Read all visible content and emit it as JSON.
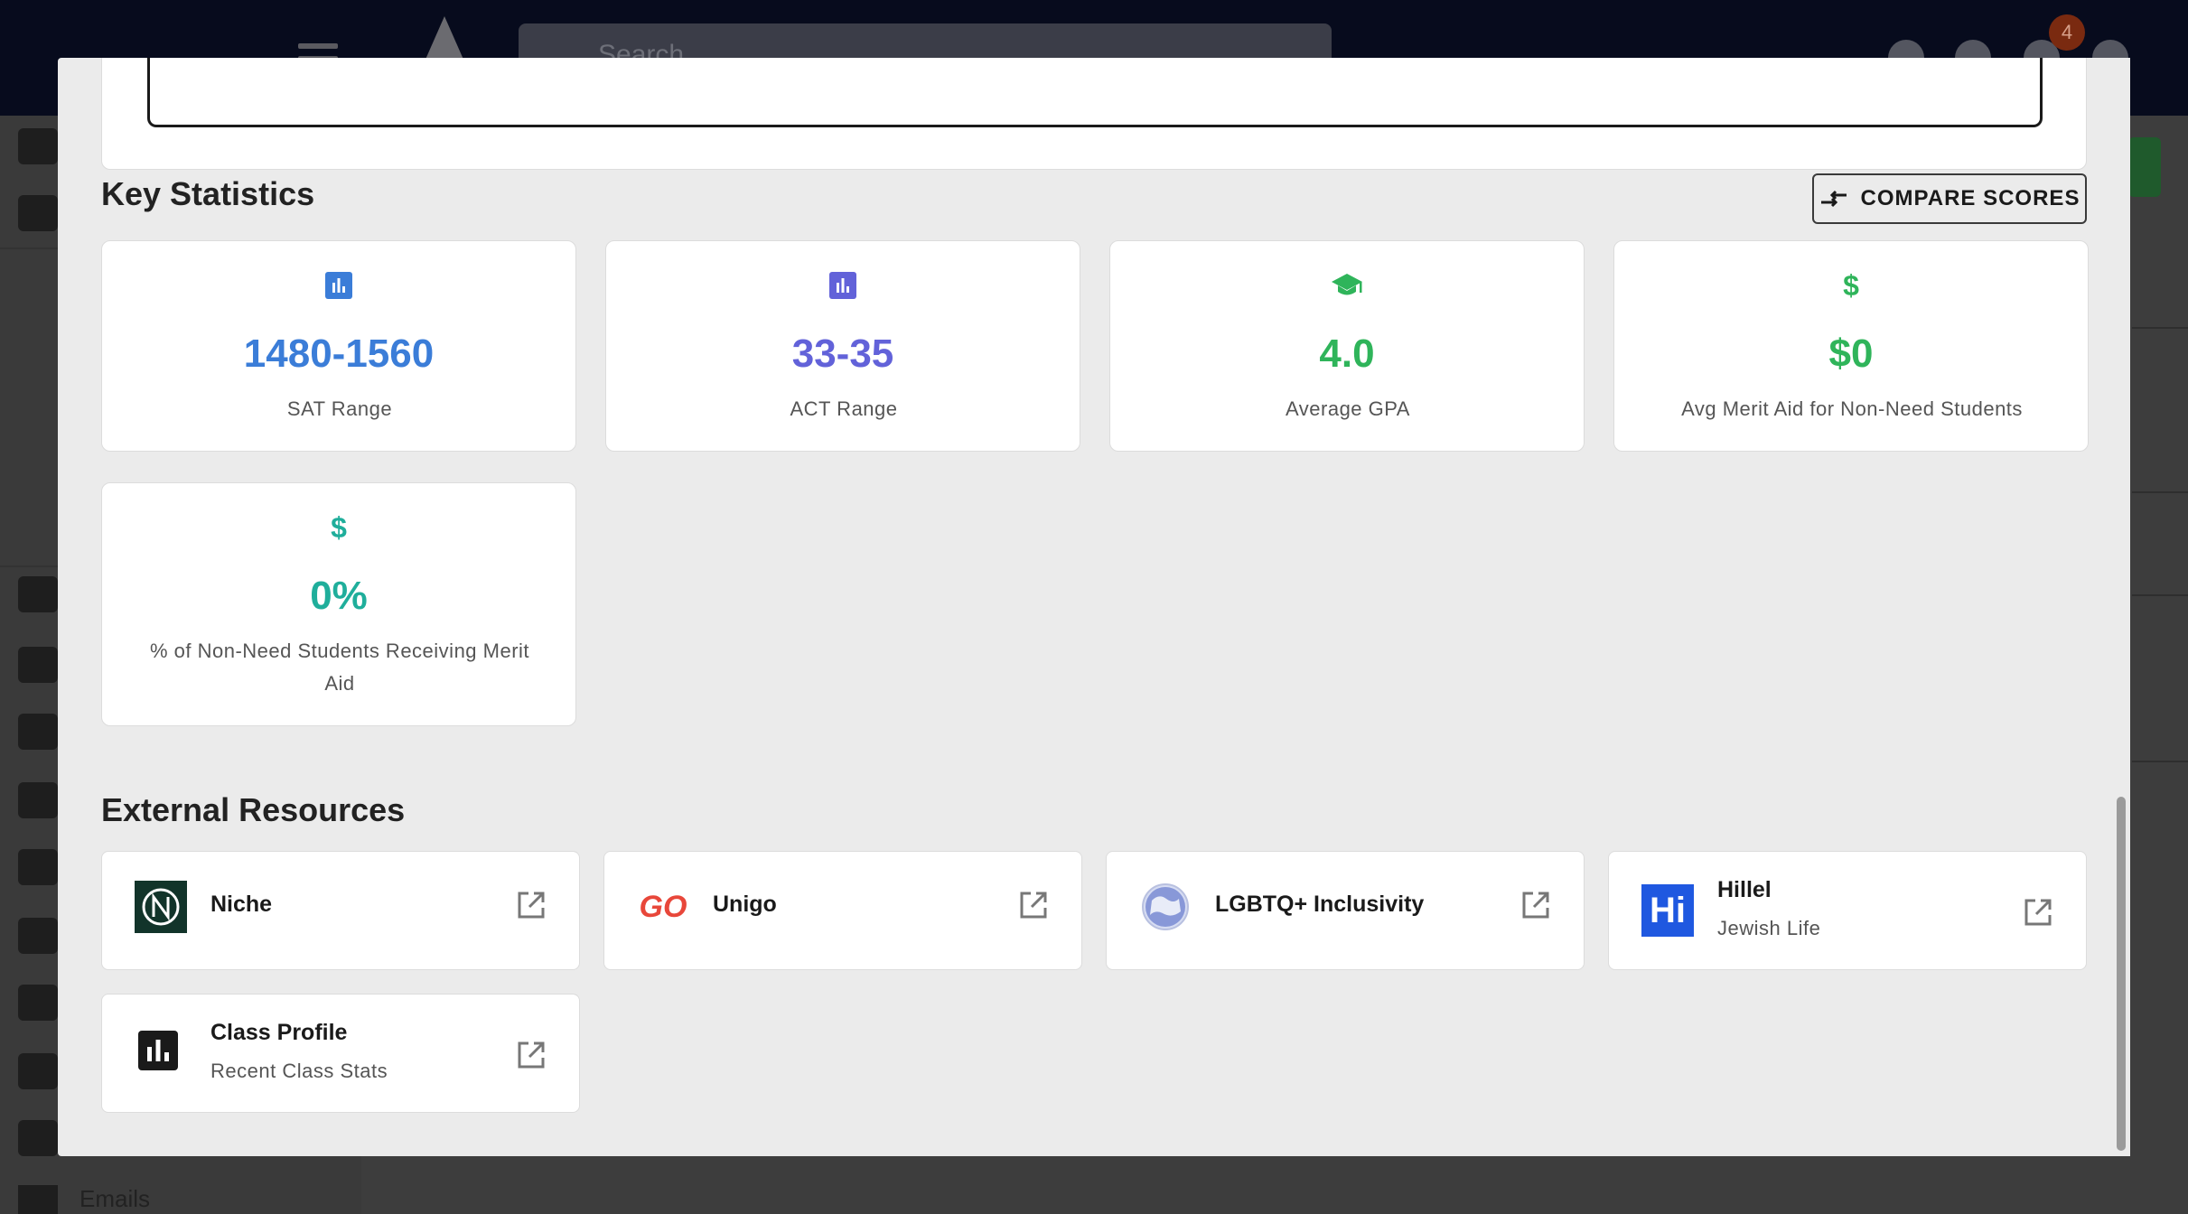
{
  "topbar": {
    "search_placeholder": "Search",
    "notification_count": "4"
  },
  "sidebar": {
    "emails_label": "Emails"
  },
  "key_statistics": {
    "title": "Key Statistics",
    "compare_label": "COMPARE SCORES",
    "stats": [
      {
        "value": "1480-1560",
        "label": "SAT Range",
        "icon": "bar-chart-icon",
        "color": "#3b7dd8"
      },
      {
        "value": "33-35",
        "label": "ACT Range",
        "icon": "bar-chart-icon",
        "color": "#6262d9"
      },
      {
        "value": "4.0",
        "label": "Average GPA",
        "icon": "graduation-cap-icon",
        "color": "#2fb45a"
      },
      {
        "value": "$0",
        "label": "Avg Merit Aid for Non-Need Students",
        "icon": "dollar-icon",
        "color": "#2fb45a"
      },
      {
        "value": "0%",
        "label": "% of Non-Need Students Receiving Merit Aid",
        "icon": "dollar-icon",
        "color": "#1fae9b"
      }
    ]
  },
  "external_resources": {
    "title": "External Resources",
    "items": [
      {
        "title": "Niche",
        "subtitle": "",
        "logo": "niche-logo"
      },
      {
        "title": "Unigo",
        "subtitle": "",
        "logo": "unigo-logo",
        "logo_text": "GO"
      },
      {
        "title": "LGBTQ+ Inclusivity",
        "subtitle": "",
        "logo": "globe-logo"
      },
      {
        "title": "Hillel",
        "subtitle": "Jewish Life",
        "logo": "hillel-logo",
        "logo_text": "Hi"
      },
      {
        "title": "Class Profile",
        "subtitle": "Recent Class Stats",
        "logo": "bar-chart-logo"
      }
    ]
  }
}
